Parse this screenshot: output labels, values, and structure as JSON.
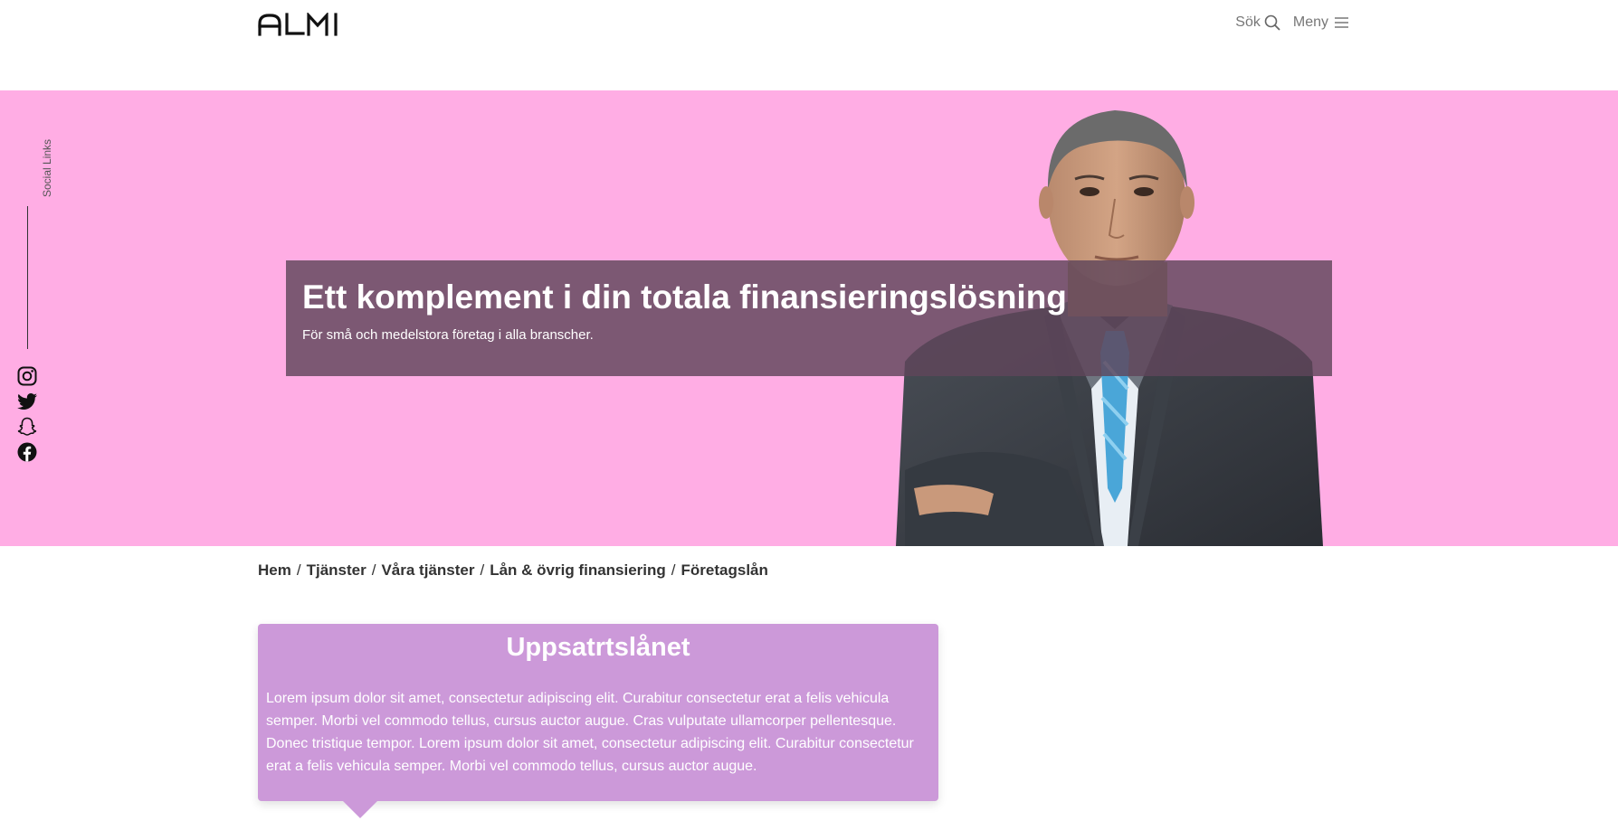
{
  "header": {
    "logo_text": "ALMI",
    "search_label": "Sök",
    "menu_label": "Meny"
  },
  "social": {
    "label": "Social Links",
    "icons": [
      "instagram-icon",
      "twitter-icon",
      "snapchat-icon",
      "facebook-icon"
    ]
  },
  "hero": {
    "title": "Ett komplement i din totala finansieringslösning",
    "subtitle": "För små och medelstora företag i alla branscher.",
    "background": "#ffade4"
  },
  "breadcrumb": {
    "items": [
      "Hem",
      "Tjänster",
      "Våra tjänster",
      "Lån & övrig finansiering",
      "Företagslån"
    ],
    "separator": "/"
  },
  "card": {
    "title": "Uppsatrtslånet",
    "body": "Lorem ipsum dolor sit amet, consectetur adipiscing elit. Curabitur consectetur erat a felis vehicula semper. Morbi vel commodo tellus, cursus auctor augue. Cras vulputate ullamcorper pellentesque. Donec tristique tempor. Lorem ipsum dolor sit amet, consectetur adipiscing elit. Curabitur consectetur erat a felis vehicula semper. Morbi vel commodo tellus, cursus auctor augue.",
    "background": "#cc99d9"
  }
}
